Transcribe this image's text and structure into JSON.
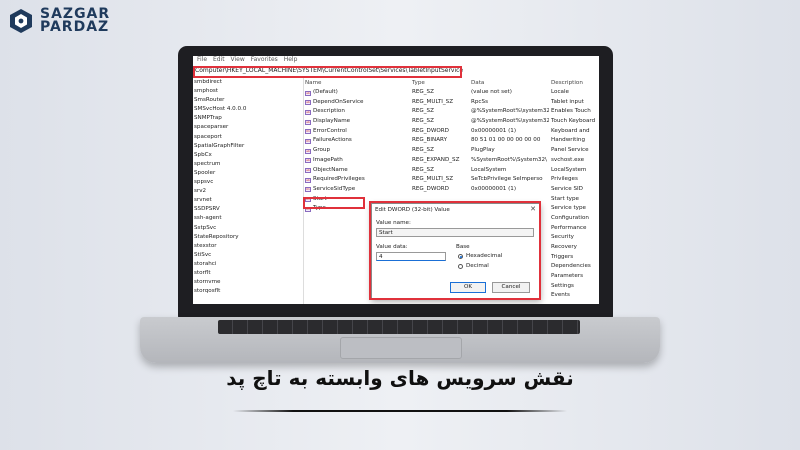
{
  "brand": {
    "line1": "SAZGAR",
    "line2": "PARDAZ",
    "color": "#1f3a5c"
  },
  "menu": [
    "File",
    "Edit",
    "View",
    "Favorites",
    "Help"
  ],
  "address": "Computer\\HKEY_LOCAL_MACHINE\\SYSTEM\\CurrentControlSet\\Services\\TabletInputService",
  "tree": [
    "smbdirect",
    "smphost",
    "SmsRouter",
    "SMSvcHost 4.0.0.0",
    "SNMPTrap",
    "spaceparser",
    "spaceport",
    "SpatialGraphFilter",
    "SpbCx",
    "spectrum",
    "Spooler",
    "sppsvc",
    "srv2",
    "srvnet",
    "SSDPSRV",
    "ssh-agent",
    "SstpSvc",
    "StateRepository",
    "stexstor",
    "StiSvc",
    "storahci",
    "storflt",
    "stornvme",
    "storqosflt"
  ],
  "columns": {
    "name": "Name",
    "type": "Type",
    "data": "Data",
    "desc": "Description"
  },
  "rows": [
    {
      "name": "(Default)",
      "type": "REG_SZ",
      "data": "(value not set)",
      "desc": "Locale",
      "icon": "string-value-icon"
    },
    {
      "name": "DependOnService",
      "type": "REG_MULTI_SZ",
      "data": "RpcSs",
      "desc": "Tablet input",
      "icon": "string-value-icon"
    },
    {
      "name": "Description",
      "type": "REG_SZ",
      "data": "@%SystemRoot%\\system32",
      "desc": "Enables Touch",
      "icon": "string-value-icon"
    },
    {
      "name": "DisplayName",
      "type": "REG_SZ",
      "data": "@%SystemRoot%\\system32",
      "desc": "Touch Keyboard",
      "icon": "string-value-icon"
    },
    {
      "name": "ErrorControl",
      "type": "REG_DWORD",
      "data": "0x00000001 (1)",
      "desc": "Keyboard and",
      "icon": "binary-value-icon"
    },
    {
      "name": "FailureActions",
      "type": "REG_BINARY",
      "data": "80 51 01 00 00 00 00 00",
      "desc": "Handwriting",
      "icon": "binary-value-icon"
    },
    {
      "name": "Group",
      "type": "REG_SZ",
      "data": "PlugPlay",
      "desc": "Panel Service",
      "icon": "string-value-icon"
    },
    {
      "name": "ImagePath",
      "type": "REG_EXPAND_SZ",
      "data": "%SystemRoot%\\System32\\",
      "desc": "svchost.exe",
      "icon": "string-value-icon"
    },
    {
      "name": "ObjectName",
      "type": "REG_SZ",
      "data": "LocalSystem",
      "desc": "LocalSystem",
      "icon": "string-value-icon"
    },
    {
      "name": "RequiredPrivileges",
      "type": "REG_MULTI_SZ",
      "data": "SeTcbPrivilege SeImperso",
      "desc": "Privileges",
      "icon": "string-value-icon"
    },
    {
      "name": "ServiceSidType",
      "type": "REG_DWORD",
      "data": "0x00000001 (1)",
      "desc": "Service SID",
      "icon": "binary-value-icon"
    },
    {
      "name": "Start",
      "type": "",
      "data": "",
      "desc": "Start type",
      "icon": "binary-value-icon"
    },
    {
      "name": "Type",
      "type": "",
      "data": "",
      "desc": "Service type",
      "icon": "binary-value-icon"
    }
  ],
  "desc_extra": [
    "Configuration",
    "Performance",
    "Security",
    "Recovery",
    "Triggers",
    "Dependencies",
    "Parameters",
    "Settings",
    "Events"
  ],
  "dialog": {
    "title": "Edit DWORD (32-bit) Value",
    "close": "✕",
    "value_name_label": "Value name:",
    "value_name": "Start",
    "value_data_label": "Value data:",
    "value_data": "4",
    "base_label": "Base",
    "hex_label": "Hexadecimal",
    "dec_label": "Decimal",
    "ok": "OK",
    "cancel": "Cancel"
  },
  "caption": "نقش سرویس های وابسته به تاچ پد",
  "highlight_color": "#e0313b"
}
